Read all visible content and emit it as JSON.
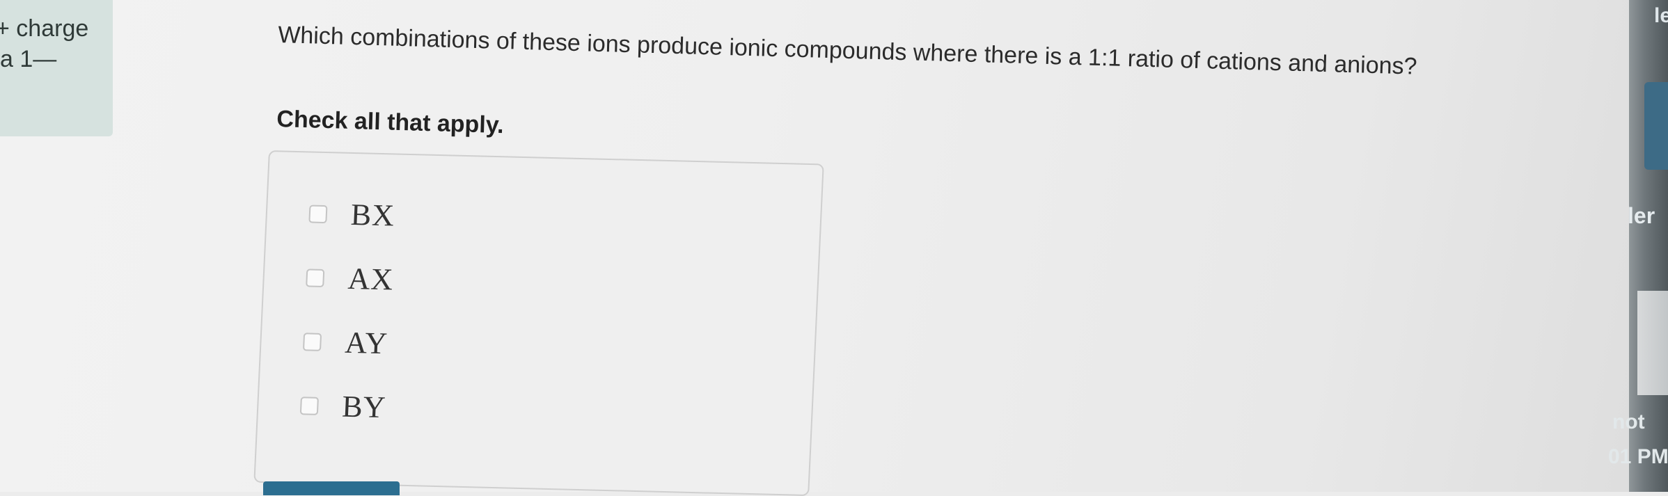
{
  "sidebar_hint": {
    "line1": "+ charge",
    "line2": "a 1—"
  },
  "question": {
    "text": "Which combinations of these ions produce ionic compounds where there is a 1:1 ratio of cations and anions?",
    "instruction": "Check all that apply."
  },
  "choices": [
    {
      "label": "BX",
      "checked": false
    },
    {
      "label": "AX",
      "checked": false
    },
    {
      "label": "AY",
      "checked": false
    },
    {
      "label": "BY",
      "checked": false
    }
  ],
  "right_edge": {
    "text_top": "le",
    "text_mid": "ler",
    "text_bottom1": "not",
    "text_bottom2": "01 PM"
  },
  "colors": {
    "hint_panel": "#d6e2df",
    "submit_button": "#2c6e90"
  }
}
